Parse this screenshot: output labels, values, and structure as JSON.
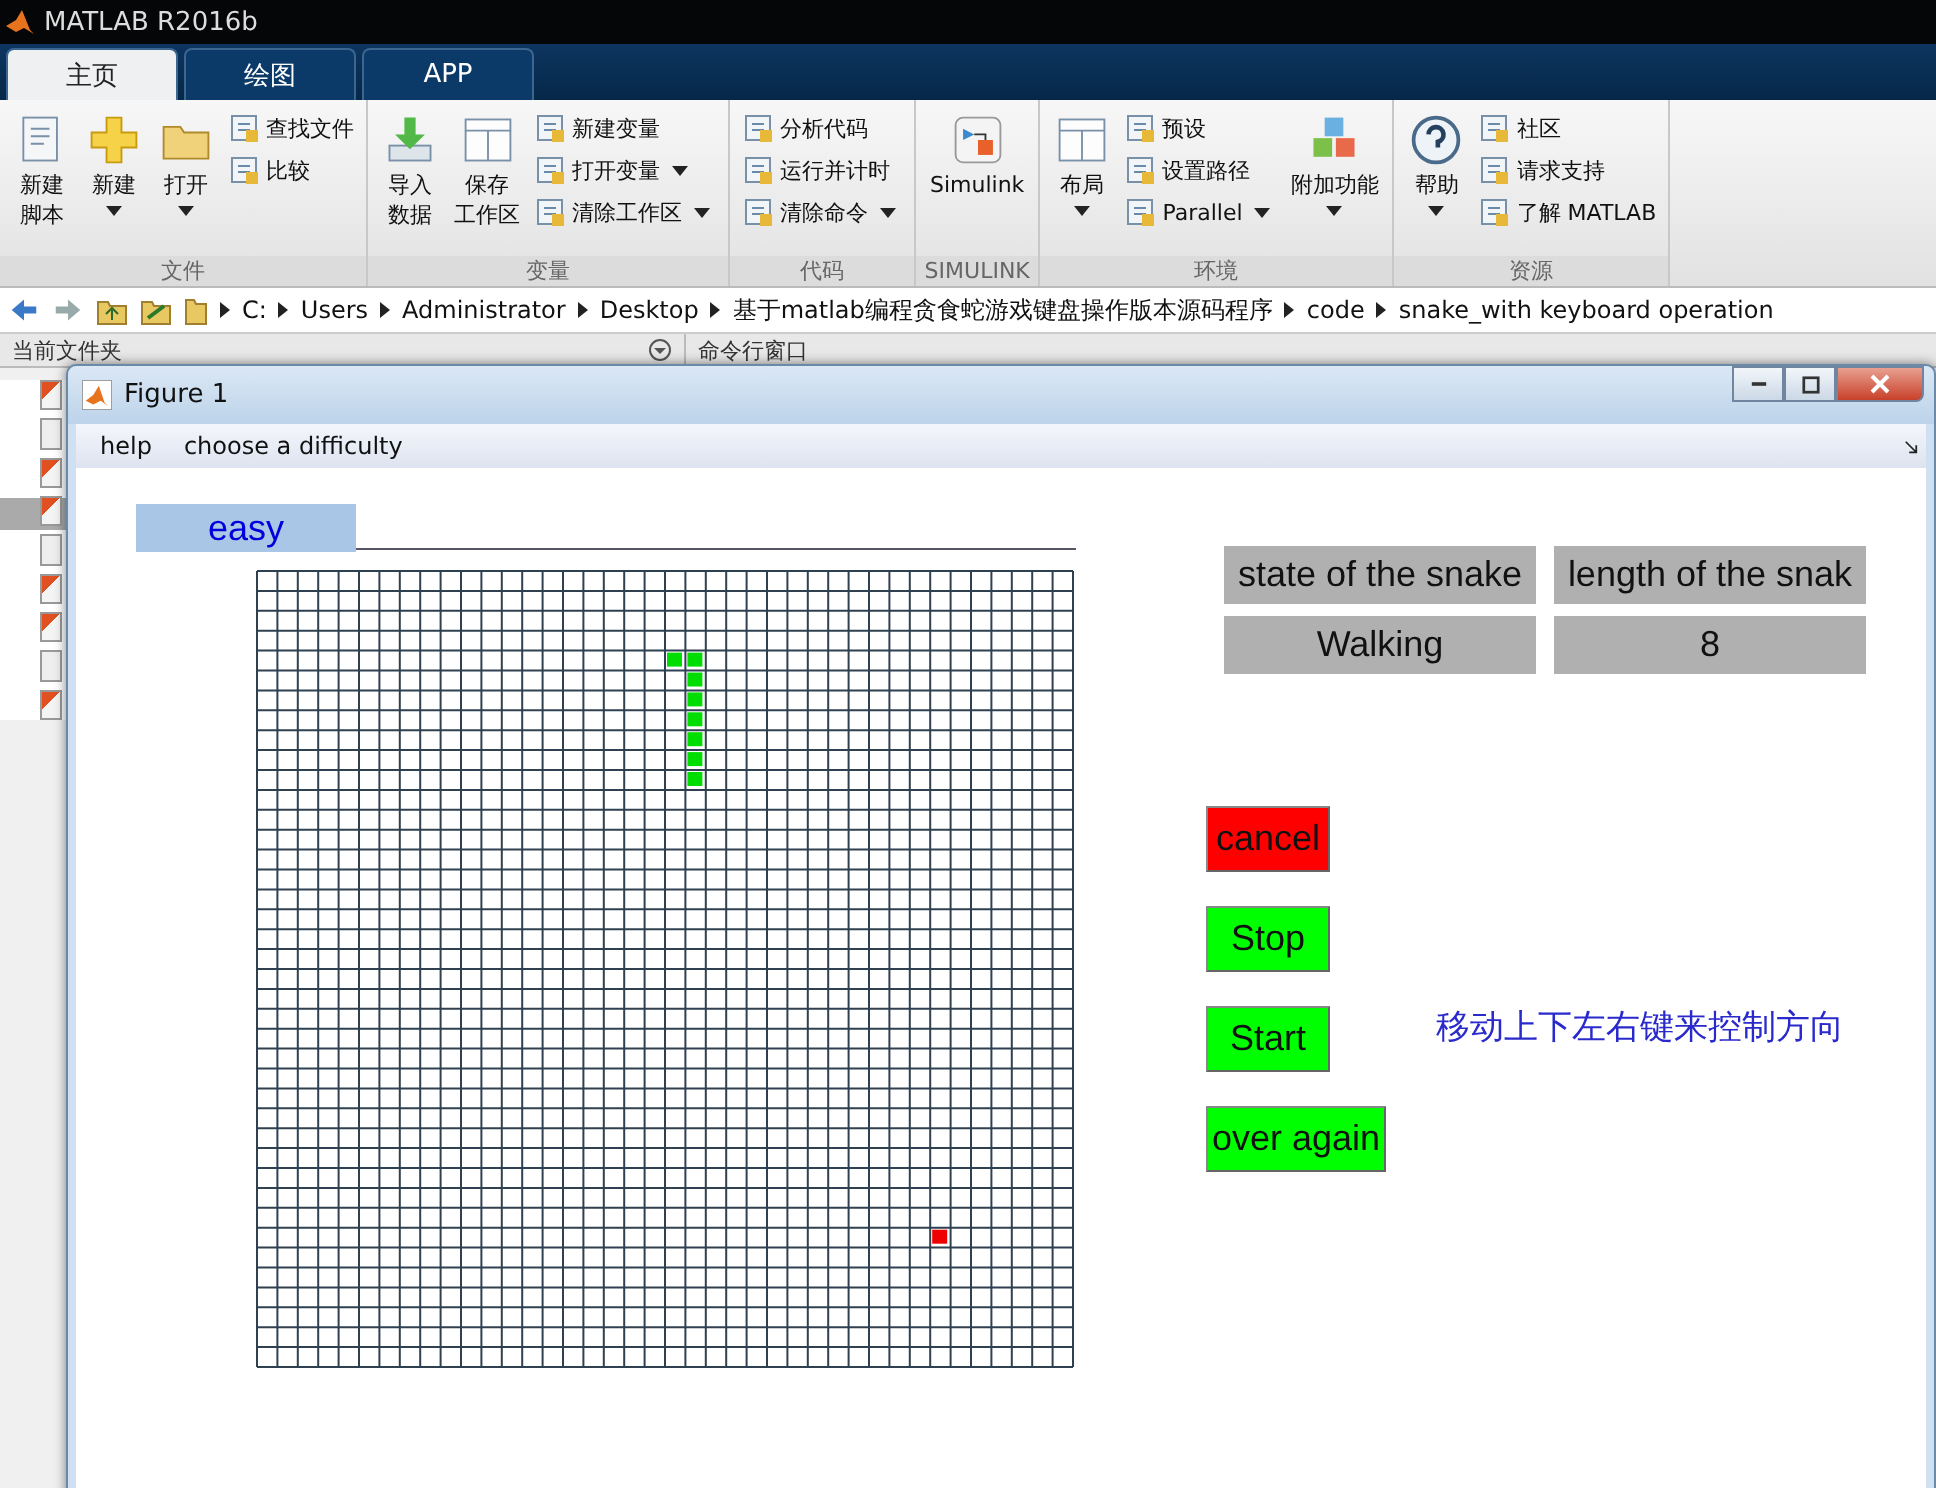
{
  "app": {
    "title": "MATLAB R2016b"
  },
  "tabs": [
    {
      "label": "主页",
      "selected": true
    },
    {
      "label": "绘图",
      "selected": false
    },
    {
      "label": "APP",
      "selected": false
    }
  ],
  "ribbon_groups": [
    {
      "label": "文件",
      "items": [
        {
          "label": [
            "新建",
            "脚本"
          ],
          "kind": "large",
          "dropdown": false
        },
        {
          "label": "新建",
          "kind": "large",
          "dropdown": true
        },
        {
          "label": "打开",
          "kind": "large",
          "dropdown": true
        },
        {
          "label": "查找文件",
          "kind": "small",
          "dropdown": false
        },
        {
          "label": "比较",
          "kind": "small",
          "dropdown": false
        }
      ]
    },
    {
      "label": "变量",
      "items": [
        {
          "label": [
            "导入",
            "数据"
          ],
          "kind": "large",
          "dropdown": false
        },
        {
          "label": [
            "保存",
            "工作区"
          ],
          "kind": "large",
          "dropdown": false
        },
        {
          "label": "新建变量",
          "kind": "small",
          "dropdown": false
        },
        {
          "label": "打开变量",
          "kind": "small",
          "dropdown": true
        },
        {
          "label": "清除工作区",
          "kind": "small",
          "dropdown": true
        }
      ]
    },
    {
      "label": "代码",
      "items": [
        {
          "label": "分析代码",
          "kind": "small",
          "dropdown": false
        },
        {
          "label": "运行并计时",
          "kind": "small",
          "dropdown": false
        },
        {
          "label": "清除命令",
          "kind": "small",
          "dropdown": true
        }
      ]
    },
    {
      "label": "SIMULINK",
      "items": [
        {
          "label": "Simulink",
          "kind": "large",
          "dropdown": false
        }
      ]
    },
    {
      "label": "环境",
      "items": [
        {
          "label": "布局",
          "kind": "large",
          "dropdown": true
        },
        {
          "label": "预设",
          "kind": "small",
          "dropdown": false
        },
        {
          "label": "设置路径",
          "kind": "small",
          "dropdown": false
        },
        {
          "label": "Parallel",
          "kind": "small",
          "dropdown": true
        },
        {
          "label": "附加功能",
          "kind": "large",
          "dropdown": true
        }
      ]
    },
    {
      "label": "资源",
      "items": [
        {
          "label": "帮助",
          "kind": "large",
          "dropdown": true
        },
        {
          "label": "社区",
          "kind": "small",
          "dropdown": false
        },
        {
          "label": "请求支持",
          "kind": "small",
          "dropdown": false
        },
        {
          "label": "了解 MATLAB",
          "kind": "small",
          "dropdown": false
        }
      ]
    }
  ],
  "address_bar": {
    "path": [
      "C:",
      "Users",
      "Administrator",
      "Desktop",
      "基于matlab编程贪食蛇游戏键盘操作版本源码程序",
      "code",
      "snake_with keyboard operation"
    ]
  },
  "panels": [
    {
      "title": "当前文件夹"
    },
    {
      "title": "命令行窗口"
    }
  ],
  "figure": {
    "title": "Figure 1",
    "menus": [
      "help",
      "choose a difficulty"
    ],
    "difficulty": "easy",
    "info_table": {
      "headers": [
        "state of the snake",
        "length of the snak"
      ],
      "values": [
        "Walking",
        "8"
      ]
    },
    "buttons": [
      {
        "label": "cancel",
        "color": "#ff0000"
      },
      {
        "label": "Stop",
        "color": "#00ff00"
      },
      {
        "label": "Start",
        "color": "#00ff00"
      },
      {
        "label": "over again",
        "color": "#00ff00"
      }
    ],
    "hint": "移动上下左右键来控制方向"
  }
}
